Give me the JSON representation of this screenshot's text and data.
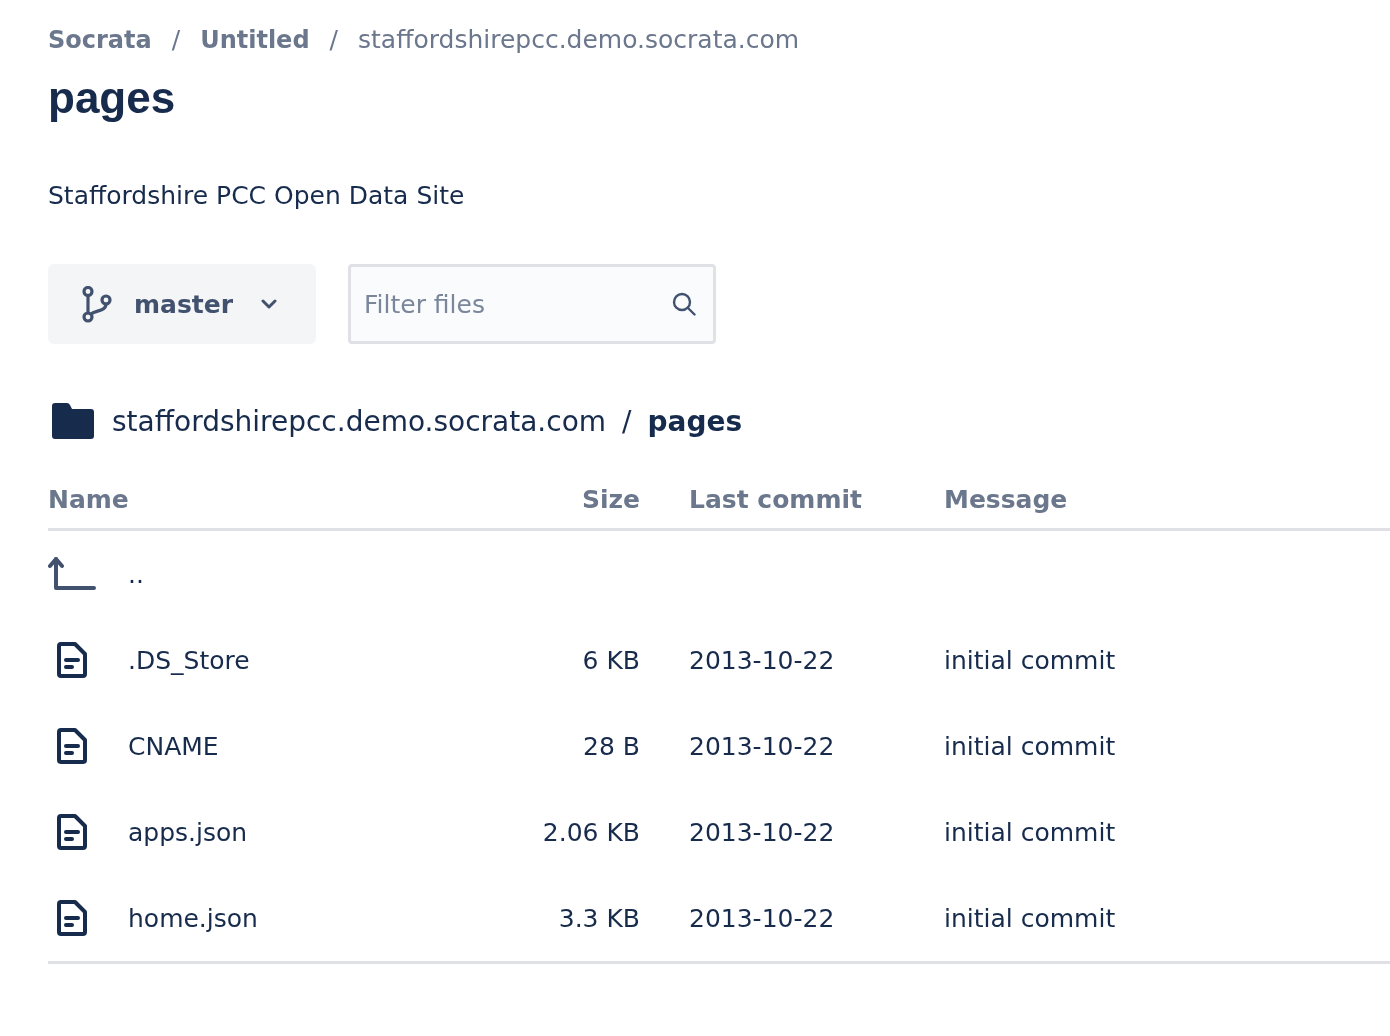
{
  "breadcrumbs": [
    {
      "kind": "link",
      "label": "Socrata"
    },
    {
      "kind": "separator",
      "label": "/"
    },
    {
      "kind": "link",
      "label": "Untitled"
    },
    {
      "kind": "separator",
      "label": "/"
    },
    {
      "kind": "current",
      "label": "staffordshirepcc.demo.socrata.com"
    }
  ],
  "title": "pages",
  "description": "Staffordshire PCC Open Data Site",
  "branch_selector": {
    "label": "master"
  },
  "filter": {
    "placeholder": "Filter files"
  },
  "path": [
    {
      "kind": "folder",
      "label": "staffordshirepcc.demo.socrata.com"
    },
    {
      "kind": "separator",
      "label": "/"
    },
    {
      "kind": "current",
      "label": "pages"
    }
  ],
  "table": {
    "columns": [
      "Name",
      "Size",
      "Last commit",
      "Message"
    ],
    "rows": [
      {
        "kind": "parent",
        "name": ".."
      },
      {
        "kind": "file",
        "name": ".DS_Store",
        "size": "6 KB",
        "last_commit": "2013-10-22",
        "message": "initial commit"
      },
      {
        "kind": "file",
        "name": "CNAME",
        "size": "28 B",
        "last_commit": "2013-10-22",
        "message": "initial commit"
      },
      {
        "kind": "file",
        "name": "apps.json",
        "size": "2.06 KB",
        "last_commit": "2013-10-22",
        "message": "initial commit"
      },
      {
        "kind": "file",
        "name": "home.json",
        "size": "3.3 KB",
        "last_commit": "2013-10-22",
        "message": "initial commit"
      }
    ]
  }
}
